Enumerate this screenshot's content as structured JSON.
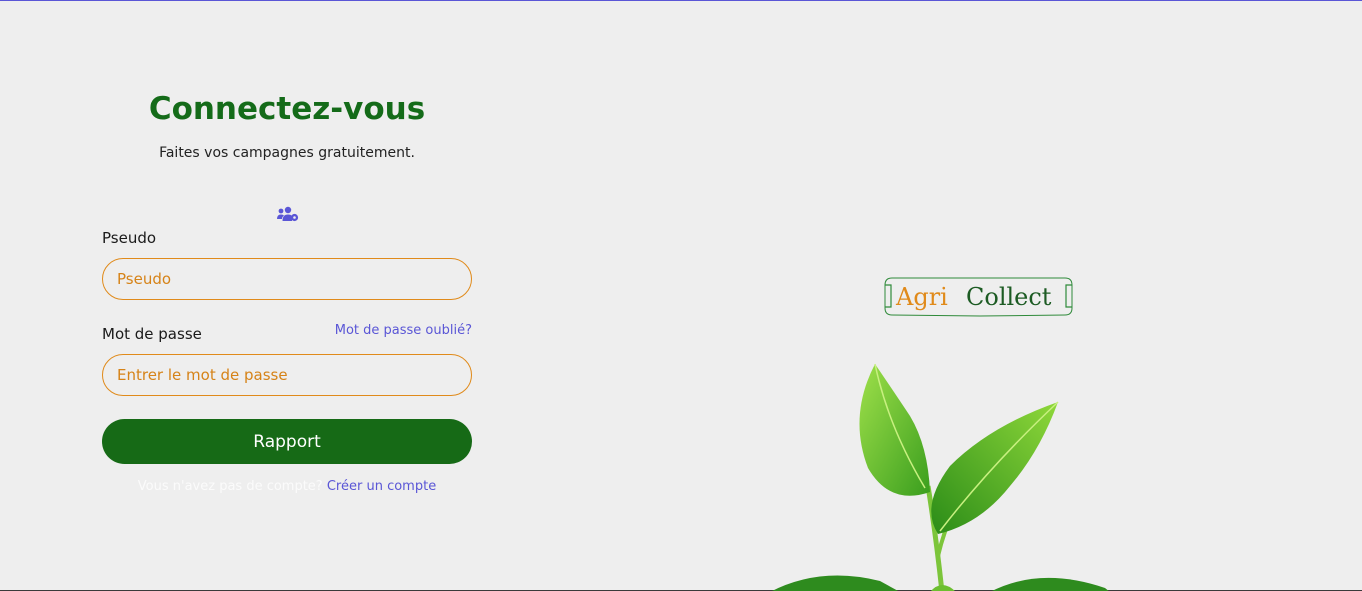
{
  "login": {
    "title": "Connectez-vous",
    "subtitle": "Faites vos campagnes gratuitement.",
    "users_icon": "users-cog-icon",
    "pseudo_label": "Pseudo",
    "pseudo_placeholder": "Pseudo",
    "password_label": "Mot de passe",
    "forgot_link": "Mot de passe oublié?",
    "password_placeholder": "Entrer le mot de passe",
    "submit_label": "Rapport",
    "no_account_text": "Vous n'avez pas de compte?",
    "signup_link": "Créer un compte"
  },
  "brand": {
    "logo_text_part1": "Agri",
    "logo_text_part2": "Collect"
  },
  "colors": {
    "title_green": "#146b19",
    "button_green": "#166a16",
    "input_border_orange": "#e08a1a",
    "link_blue": "#5a56d6",
    "background": "#eeeeee"
  }
}
